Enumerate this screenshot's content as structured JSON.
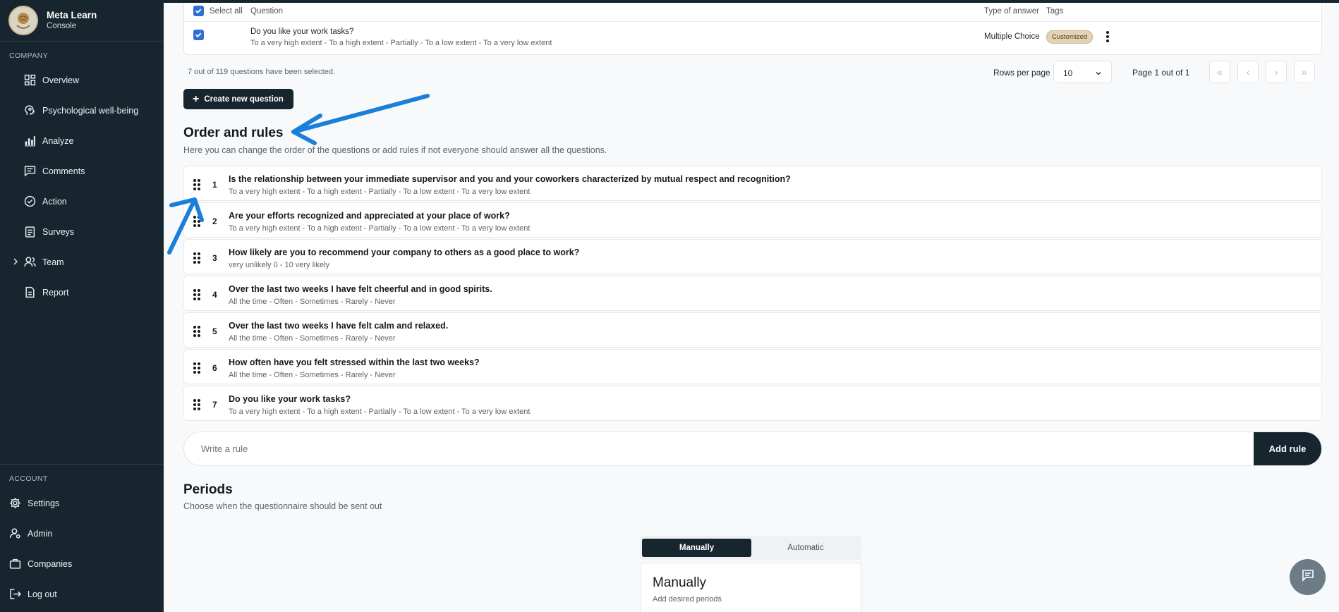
{
  "app": {
    "title": "Meta Learn",
    "subtitle": "Console"
  },
  "sidebar": {
    "company_label": "COMPANY",
    "items": [
      {
        "label": "Overview",
        "icon": "grid-icon"
      },
      {
        "label": "Psychological well-being",
        "icon": "head-icon"
      },
      {
        "label": "Analyze",
        "icon": "bar-chart-icon"
      },
      {
        "label": "Comments",
        "icon": "comment-icon"
      },
      {
        "label": "Action",
        "icon": "check-circle-icon"
      },
      {
        "label": "Surveys",
        "icon": "clipboard-icon"
      },
      {
        "label": "Team",
        "icon": "users-icon"
      },
      {
        "label": "Report",
        "icon": "document-icon"
      }
    ],
    "account_label": "ACCOUNT",
    "account_items": [
      {
        "label": "Settings",
        "icon": "gear-icon"
      },
      {
        "label": "Admin",
        "icon": "admin-icon"
      },
      {
        "label": "Companies",
        "icon": "briefcase-icon"
      },
      {
        "label": "Log out",
        "icon": "logout-icon"
      }
    ]
  },
  "question_table": {
    "headers": {
      "select_all": "Select all",
      "question": "Question",
      "type": "Type of answer",
      "tags": "Tags"
    },
    "row": {
      "title": "Do you like your work tasks?",
      "scale": "To a very high extent - To a high extent - Partially - To a low extent - To a very low extent",
      "type": "Multiple Choice",
      "tag": "Customized"
    },
    "selected_info": "7 out of 119 questions have been selected.",
    "rows_per_page_label": "Rows per page",
    "rows_per_page_value": "10",
    "page_info": "Page 1 out of 1"
  },
  "create_button": "Create new question",
  "order_section": {
    "title": "Order and rules",
    "description": "Here you can change the order of the questions or add rules if not everyone should answer all the questions.",
    "items": [
      {
        "num": "1",
        "title": "Is the relationship between your immediate supervisor and you and your coworkers characterized by mutual respect and recognition?",
        "scale": "To a very high extent - To a high extent - Partially - To a low extent - To a very low extent"
      },
      {
        "num": "2",
        "title": "Are your efforts recognized and appreciated at your place of work?",
        "scale": "To a very high extent - To a high extent - Partially - To a low extent - To a very low extent"
      },
      {
        "num": "3",
        "title": "How likely are you to recommend your company to others as a good place to work?",
        "scale": "very unlikely 0 - 10 very likely"
      },
      {
        "num": "4",
        "title": "Over the last two weeks I have felt cheerful and in good spirits.",
        "scale": "All the time - Often - Sometimes - Rarely - Never"
      },
      {
        "num": "5",
        "title": "Over the last two weeks I have felt calm and relaxed.",
        "scale": "All the time - Often - Sometimes - Rarely - Never"
      },
      {
        "num": "6",
        "title": "How often have you felt stressed within the last two weeks?",
        "scale": "All the time - Often - Sometimes - Rarely - Never"
      },
      {
        "num": "7",
        "title": "Do you like your work tasks?",
        "scale": "To a very high extent - To a high extent - Partially - To a low extent - To a very low extent"
      }
    ],
    "rule_placeholder": "Write a rule",
    "add_rule": "Add rule"
  },
  "periods": {
    "title": "Periods",
    "description": "Choose when the questionnaire should be sent out",
    "tabs": [
      "Manually",
      "Automatic"
    ],
    "active_tab": "Manually",
    "card_title": "Manually",
    "card_sub": "Add desired periods"
  },
  "colors": {
    "sidebar": "#16252e",
    "accent": "#2e6fd6",
    "annotation": "#1a7fd9"
  }
}
